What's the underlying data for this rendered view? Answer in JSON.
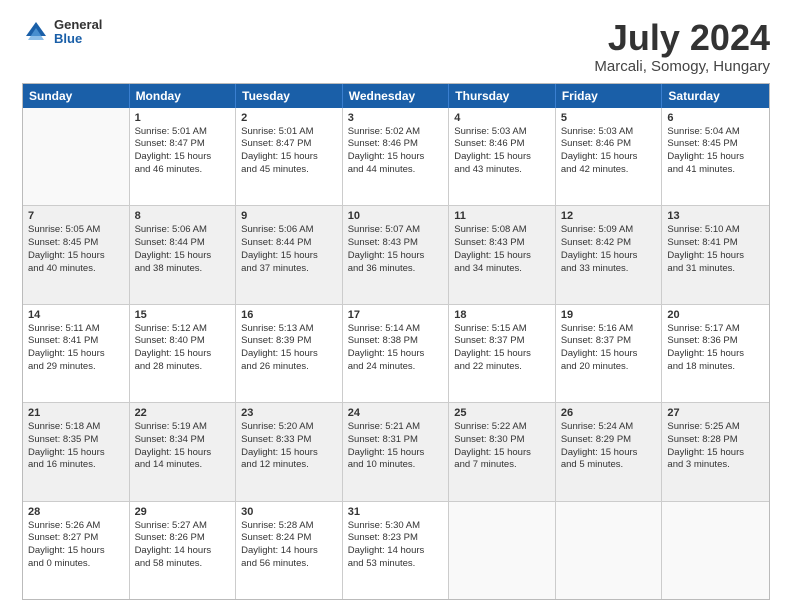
{
  "header": {
    "logo_general": "General",
    "logo_blue": "Blue",
    "main_title": "July 2024",
    "subtitle": "Marcali, Somogy, Hungary"
  },
  "weekdays": [
    "Sunday",
    "Monday",
    "Tuesday",
    "Wednesday",
    "Thursday",
    "Friday",
    "Saturday"
  ],
  "rows": [
    [
      {
        "day": "",
        "lines": [],
        "shaded": false,
        "empty": true
      },
      {
        "day": "1",
        "lines": [
          "Sunrise: 5:01 AM",
          "Sunset: 8:47 PM",
          "Daylight: 15 hours",
          "and 46 minutes."
        ],
        "shaded": false
      },
      {
        "day": "2",
        "lines": [
          "Sunrise: 5:01 AM",
          "Sunset: 8:47 PM",
          "Daylight: 15 hours",
          "and 45 minutes."
        ],
        "shaded": false
      },
      {
        "day": "3",
        "lines": [
          "Sunrise: 5:02 AM",
          "Sunset: 8:46 PM",
          "Daylight: 15 hours",
          "and 44 minutes."
        ],
        "shaded": false
      },
      {
        "day": "4",
        "lines": [
          "Sunrise: 5:03 AM",
          "Sunset: 8:46 PM",
          "Daylight: 15 hours",
          "and 43 minutes."
        ],
        "shaded": false
      },
      {
        "day": "5",
        "lines": [
          "Sunrise: 5:03 AM",
          "Sunset: 8:46 PM",
          "Daylight: 15 hours",
          "and 42 minutes."
        ],
        "shaded": false
      },
      {
        "day": "6",
        "lines": [
          "Sunrise: 5:04 AM",
          "Sunset: 8:45 PM",
          "Daylight: 15 hours",
          "and 41 minutes."
        ],
        "shaded": false
      }
    ],
    [
      {
        "day": "7",
        "lines": [
          "Sunrise: 5:05 AM",
          "Sunset: 8:45 PM",
          "Daylight: 15 hours",
          "and 40 minutes."
        ],
        "shaded": true
      },
      {
        "day": "8",
        "lines": [
          "Sunrise: 5:06 AM",
          "Sunset: 8:44 PM",
          "Daylight: 15 hours",
          "and 38 minutes."
        ],
        "shaded": true
      },
      {
        "day": "9",
        "lines": [
          "Sunrise: 5:06 AM",
          "Sunset: 8:44 PM",
          "Daylight: 15 hours",
          "and 37 minutes."
        ],
        "shaded": true
      },
      {
        "day": "10",
        "lines": [
          "Sunrise: 5:07 AM",
          "Sunset: 8:43 PM",
          "Daylight: 15 hours",
          "and 36 minutes."
        ],
        "shaded": true
      },
      {
        "day": "11",
        "lines": [
          "Sunrise: 5:08 AM",
          "Sunset: 8:43 PM",
          "Daylight: 15 hours",
          "and 34 minutes."
        ],
        "shaded": true
      },
      {
        "day": "12",
        "lines": [
          "Sunrise: 5:09 AM",
          "Sunset: 8:42 PM",
          "Daylight: 15 hours",
          "and 33 minutes."
        ],
        "shaded": true
      },
      {
        "day": "13",
        "lines": [
          "Sunrise: 5:10 AM",
          "Sunset: 8:41 PM",
          "Daylight: 15 hours",
          "and 31 minutes."
        ],
        "shaded": true
      }
    ],
    [
      {
        "day": "14",
        "lines": [
          "Sunrise: 5:11 AM",
          "Sunset: 8:41 PM",
          "Daylight: 15 hours",
          "and 29 minutes."
        ],
        "shaded": false
      },
      {
        "day": "15",
        "lines": [
          "Sunrise: 5:12 AM",
          "Sunset: 8:40 PM",
          "Daylight: 15 hours",
          "and 28 minutes."
        ],
        "shaded": false
      },
      {
        "day": "16",
        "lines": [
          "Sunrise: 5:13 AM",
          "Sunset: 8:39 PM",
          "Daylight: 15 hours",
          "and 26 minutes."
        ],
        "shaded": false
      },
      {
        "day": "17",
        "lines": [
          "Sunrise: 5:14 AM",
          "Sunset: 8:38 PM",
          "Daylight: 15 hours",
          "and 24 minutes."
        ],
        "shaded": false
      },
      {
        "day": "18",
        "lines": [
          "Sunrise: 5:15 AM",
          "Sunset: 8:37 PM",
          "Daylight: 15 hours",
          "and 22 minutes."
        ],
        "shaded": false
      },
      {
        "day": "19",
        "lines": [
          "Sunrise: 5:16 AM",
          "Sunset: 8:37 PM",
          "Daylight: 15 hours",
          "and 20 minutes."
        ],
        "shaded": false
      },
      {
        "day": "20",
        "lines": [
          "Sunrise: 5:17 AM",
          "Sunset: 8:36 PM",
          "Daylight: 15 hours",
          "and 18 minutes."
        ],
        "shaded": false
      }
    ],
    [
      {
        "day": "21",
        "lines": [
          "Sunrise: 5:18 AM",
          "Sunset: 8:35 PM",
          "Daylight: 15 hours",
          "and 16 minutes."
        ],
        "shaded": true
      },
      {
        "day": "22",
        "lines": [
          "Sunrise: 5:19 AM",
          "Sunset: 8:34 PM",
          "Daylight: 15 hours",
          "and 14 minutes."
        ],
        "shaded": true
      },
      {
        "day": "23",
        "lines": [
          "Sunrise: 5:20 AM",
          "Sunset: 8:33 PM",
          "Daylight: 15 hours",
          "and 12 minutes."
        ],
        "shaded": true
      },
      {
        "day": "24",
        "lines": [
          "Sunrise: 5:21 AM",
          "Sunset: 8:31 PM",
          "Daylight: 15 hours",
          "and 10 minutes."
        ],
        "shaded": true
      },
      {
        "day": "25",
        "lines": [
          "Sunrise: 5:22 AM",
          "Sunset: 8:30 PM",
          "Daylight: 15 hours",
          "and 7 minutes."
        ],
        "shaded": true
      },
      {
        "day": "26",
        "lines": [
          "Sunrise: 5:24 AM",
          "Sunset: 8:29 PM",
          "Daylight: 15 hours",
          "and 5 minutes."
        ],
        "shaded": true
      },
      {
        "day": "27",
        "lines": [
          "Sunrise: 5:25 AM",
          "Sunset: 8:28 PM",
          "Daylight: 15 hours",
          "and 3 minutes."
        ],
        "shaded": true
      }
    ],
    [
      {
        "day": "28",
        "lines": [
          "Sunrise: 5:26 AM",
          "Sunset: 8:27 PM",
          "Daylight: 15 hours",
          "and 0 minutes."
        ],
        "shaded": false
      },
      {
        "day": "29",
        "lines": [
          "Sunrise: 5:27 AM",
          "Sunset: 8:26 PM",
          "Daylight: 14 hours",
          "and 58 minutes."
        ],
        "shaded": false
      },
      {
        "day": "30",
        "lines": [
          "Sunrise: 5:28 AM",
          "Sunset: 8:24 PM",
          "Daylight: 14 hours",
          "and 56 minutes."
        ],
        "shaded": false
      },
      {
        "day": "31",
        "lines": [
          "Sunrise: 5:30 AM",
          "Sunset: 8:23 PM",
          "Daylight: 14 hours",
          "and 53 minutes."
        ],
        "shaded": false
      },
      {
        "day": "",
        "lines": [],
        "shaded": false,
        "empty": true
      },
      {
        "day": "",
        "lines": [],
        "shaded": false,
        "empty": true
      },
      {
        "day": "",
        "lines": [],
        "shaded": false,
        "empty": true
      }
    ]
  ]
}
